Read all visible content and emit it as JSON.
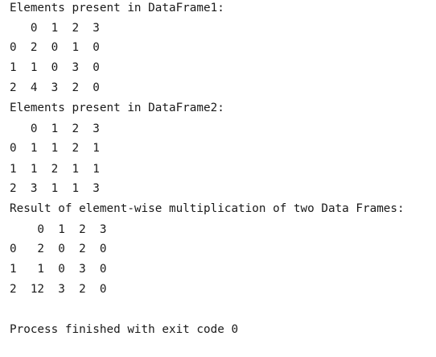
{
  "console": {
    "lines": [
      "Elements present in DataFrame1:",
      "   0  1  2  3",
      "0  2  0  1  0",
      "1  1  0  3  0",
      "2  4  3  2  0",
      "Elements present in DataFrame2:",
      "   0  1  2  3",
      "0  1  1  2  1",
      "1  1  2  1  1",
      "2  3  1  1  3",
      "Result of element-wise multiplication of two Data Frames:",
      "    0  1  2  3",
      "0   2  0  2  0",
      "1   1  0  3  0",
      "2  12  3  2  0",
      "",
      "Process finished with exit code 0"
    ]
  }
}
